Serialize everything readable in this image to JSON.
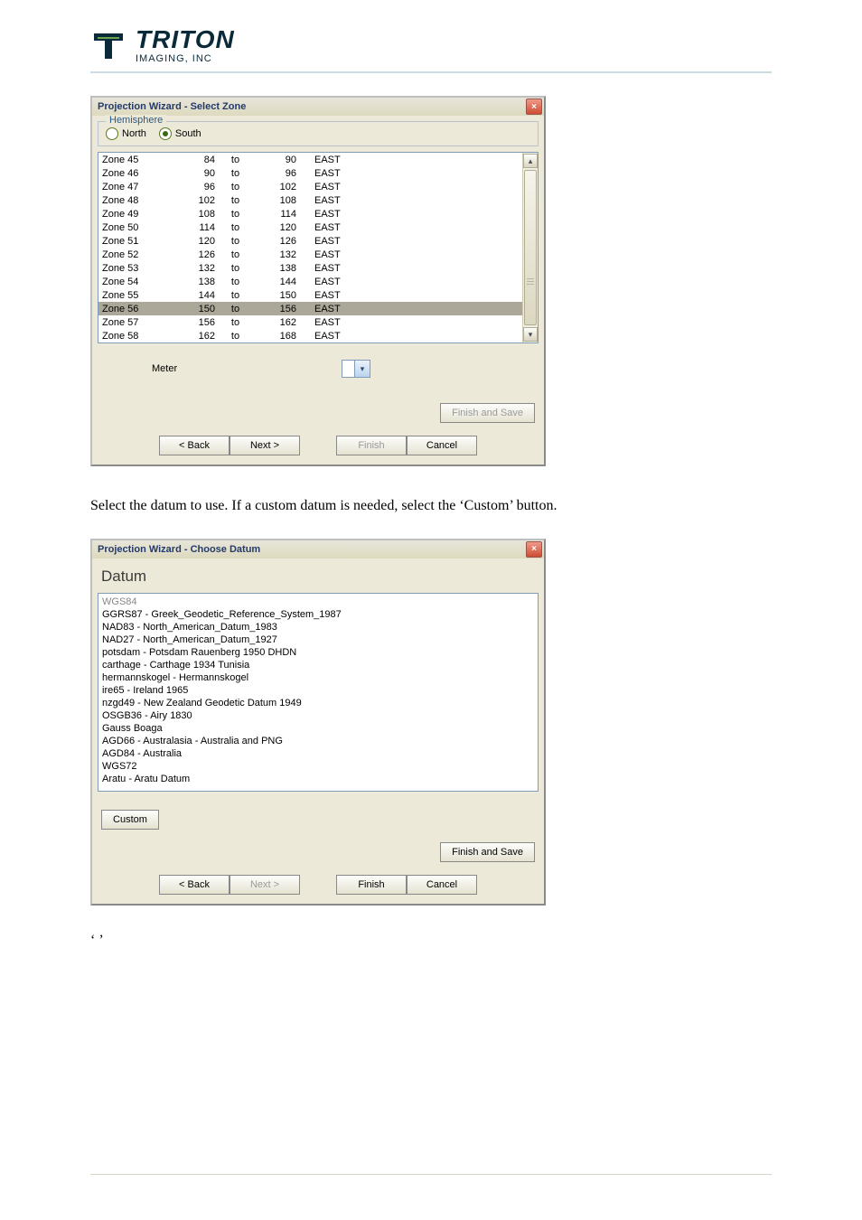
{
  "logo": {
    "name": "TRITON",
    "sub": "IMAGING, INC"
  },
  "dialog1": {
    "title": "Projection Wizard - Select Zone",
    "group_label": "Hemisphere",
    "radio_north": "North",
    "radio_south": "South",
    "zones": [
      {
        "name": "Zone 45",
        "from": "84",
        "to": "to",
        "to2": "90",
        "dir": "EAST",
        "sel": false
      },
      {
        "name": "Zone 46",
        "from": "90",
        "to": "to",
        "to2": "96",
        "dir": "EAST",
        "sel": false
      },
      {
        "name": "Zone 47",
        "from": "96",
        "to": "to",
        "to2": "102",
        "dir": "EAST",
        "sel": false
      },
      {
        "name": "Zone 48",
        "from": "102",
        "to": "to",
        "to2": "108",
        "dir": "EAST",
        "sel": false
      },
      {
        "name": "Zone 49",
        "from": "108",
        "to": "to",
        "to2": "114",
        "dir": "EAST",
        "sel": false
      },
      {
        "name": "Zone 50",
        "from": "114",
        "to": "to",
        "to2": "120",
        "dir": "EAST",
        "sel": false
      },
      {
        "name": "Zone 51",
        "from": "120",
        "to": "to",
        "to2": "126",
        "dir": "EAST",
        "sel": false
      },
      {
        "name": "Zone 52",
        "from": "126",
        "to": "to",
        "to2": "132",
        "dir": "EAST",
        "sel": false
      },
      {
        "name": "Zone 53",
        "from": "132",
        "to": "to",
        "to2": "138",
        "dir": "EAST",
        "sel": false
      },
      {
        "name": "Zone 54",
        "from": "138",
        "to": "to",
        "to2": "144",
        "dir": "EAST",
        "sel": false
      },
      {
        "name": "Zone 55",
        "from": "144",
        "to": "to",
        "to2": "150",
        "dir": "EAST",
        "sel": false
      },
      {
        "name": "Zone 56",
        "from": "150",
        "to": "to",
        "to2": "156",
        "dir": "EAST",
        "sel": true
      },
      {
        "name": "Zone 57",
        "from": "156",
        "to": "to",
        "to2": "162",
        "dir": "EAST",
        "sel": false
      },
      {
        "name": "Zone 58",
        "from": "162",
        "to": "to",
        "to2": "168",
        "dir": "EAST",
        "sel": false
      }
    ],
    "unit": "Meter",
    "btn_finish_save": "Finish and Save",
    "btn_back": "< Back",
    "btn_next": "Next >",
    "btn_finish": "Finish",
    "btn_cancel": "Cancel"
  },
  "para1": "Select the datum to use.  If a custom datum is needed, select the ‘Custom’ button.",
  "dialog2": {
    "title": "Projection Wizard - Choose Datum",
    "heading": "Datum",
    "items": [
      {
        "t": "WGS84",
        "sel": true
      },
      {
        "t": "GGRS87 - Greek_Geodetic_Reference_System_1987",
        "sel": false
      },
      {
        "t": "NAD83 - North_American_Datum_1983",
        "sel": false
      },
      {
        "t": "NAD27 - North_American_Datum_1927",
        "sel": false
      },
      {
        "t": "potsdam - Potsdam Rauenberg 1950 DHDN",
        "sel": false
      },
      {
        "t": "carthage - Carthage 1934 Tunisia",
        "sel": false
      },
      {
        "t": "hermannskogel - Hermannskogel",
        "sel": false
      },
      {
        "t": "ire65 - Ireland 1965",
        "sel": false
      },
      {
        "t": "nzgd49 - New Zealand Geodetic Datum 1949",
        "sel": false
      },
      {
        "t": "OSGB36 - Airy 1830",
        "sel": false
      },
      {
        "t": "Gauss Boaga",
        "sel": false
      },
      {
        "t": "AGD66 - Australasia - Australia and PNG",
        "sel": false
      },
      {
        "t": "AGD84 - Australia",
        "sel": false
      },
      {
        "t": "WGS72",
        "sel": false
      },
      {
        "t": "Aratu - Aratu Datum",
        "sel": false
      }
    ],
    "btn_custom": "Custom",
    "btn_finish_save": "Finish and Save",
    "btn_back": "< Back",
    "btn_next": "Next >",
    "btn_finish": "Finish",
    "btn_cancel": "Cancel"
  },
  "quotes": "‘            ’"
}
